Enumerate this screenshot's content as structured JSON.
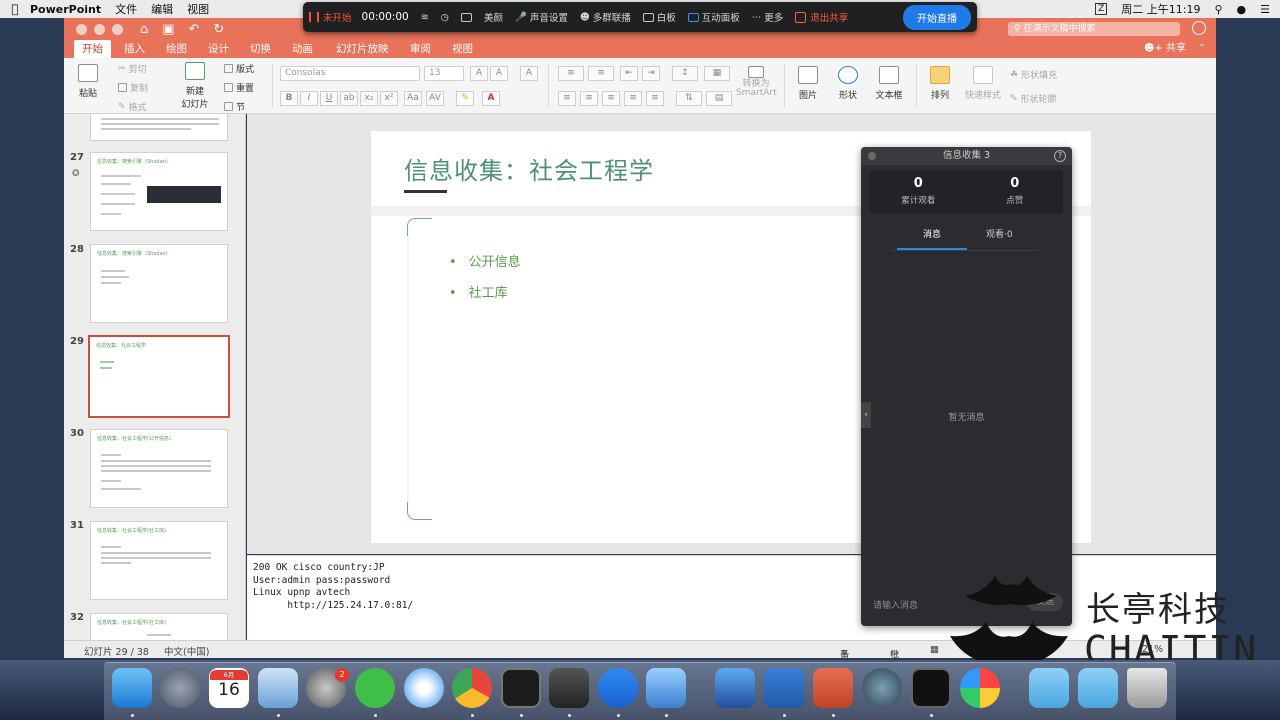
{
  "menubar": {
    "app_name": "PowerPoint",
    "items": [
      "文件",
      "编辑",
      "视图"
    ],
    "clock": "周二 上午11:19",
    "battery": "Z"
  },
  "meeting": {
    "record_label": "未开始",
    "timer": "00:00:00",
    "items": [
      "美颜",
      "声音设置",
      "多群联播",
      "白板",
      "互动面板",
      "更多"
    ],
    "exit_label": "退出共享",
    "live_button": "开始直播"
  },
  "titlebar": {
    "search_placeholder": "在演示文稿中搜索"
  },
  "ribbon_tabs": {
    "tabs": [
      "开始",
      "插入",
      "绘图",
      "设计",
      "切换",
      "动画",
      "幻灯片放映",
      "审阅",
      "视图"
    ],
    "active": "开始",
    "share": "共享"
  },
  "ribbon": {
    "paste": "粘贴",
    "cut": "剪切",
    "copy": "复制",
    "format": "格式",
    "new_slide": "新建\n幻灯片",
    "layout": "版式",
    "reset": "重置",
    "section": "节",
    "font_name": "Consolas",
    "font_size": "13",
    "convert_smartart": "转换为\nSmartArt",
    "picture": "图片",
    "shape": "形状",
    "textbox": "文本框",
    "arrange": "排列",
    "quick_styles": "快速样式",
    "shape_fill": "形状填充",
    "shape_outline": "形状轮廓"
  },
  "thumbnails": [
    {
      "num": "27",
      "title": "信息收集：搜索引擎（Shodan）"
    },
    {
      "num": "28",
      "title": "信息收集：搜索引擎（Shodan）"
    },
    {
      "num": "29",
      "title": "信息收集：社会工程学"
    },
    {
      "num": "30",
      "title": "信息收集：社会工程学(公开信息)"
    },
    {
      "num": "31",
      "title": "信息收集：社会工程学(社工库)"
    },
    {
      "num": "32",
      "title": "信息收集：社会工程学(社工库)"
    }
  ],
  "slide": {
    "title": "信息收集：社会工程学",
    "bullets": [
      "公开信息",
      "社工库"
    ]
  },
  "notes": {
    "lines": [
      "200 OK cisco country:JP",
      "User:admin pass:password",
      "Linux upnp avtech",
      "      http://125.24.17.0:81/"
    ]
  },
  "statusbar": {
    "slide_info": "幻灯片 29 / 38",
    "language": "中文(中国)",
    "notes_label": "备注",
    "comments_label": "批注",
    "zoom": "21%"
  },
  "live_panel": {
    "title": "信息收集 3",
    "views_count": "0",
    "views_label": "累计观看",
    "likes_count": "0",
    "likes_label": "点赞",
    "tab_messages": "消息",
    "tab_watching": "观看·0",
    "empty_text": "暂无消息",
    "input_placeholder": "请输入消息",
    "send_label": "发送"
  },
  "watermark": {
    "cn": "长亭科技",
    "en": "CHAITIN"
  },
  "dock": {
    "calendar_month": "6月",
    "calendar_day": "16",
    "badge_count": "2"
  }
}
